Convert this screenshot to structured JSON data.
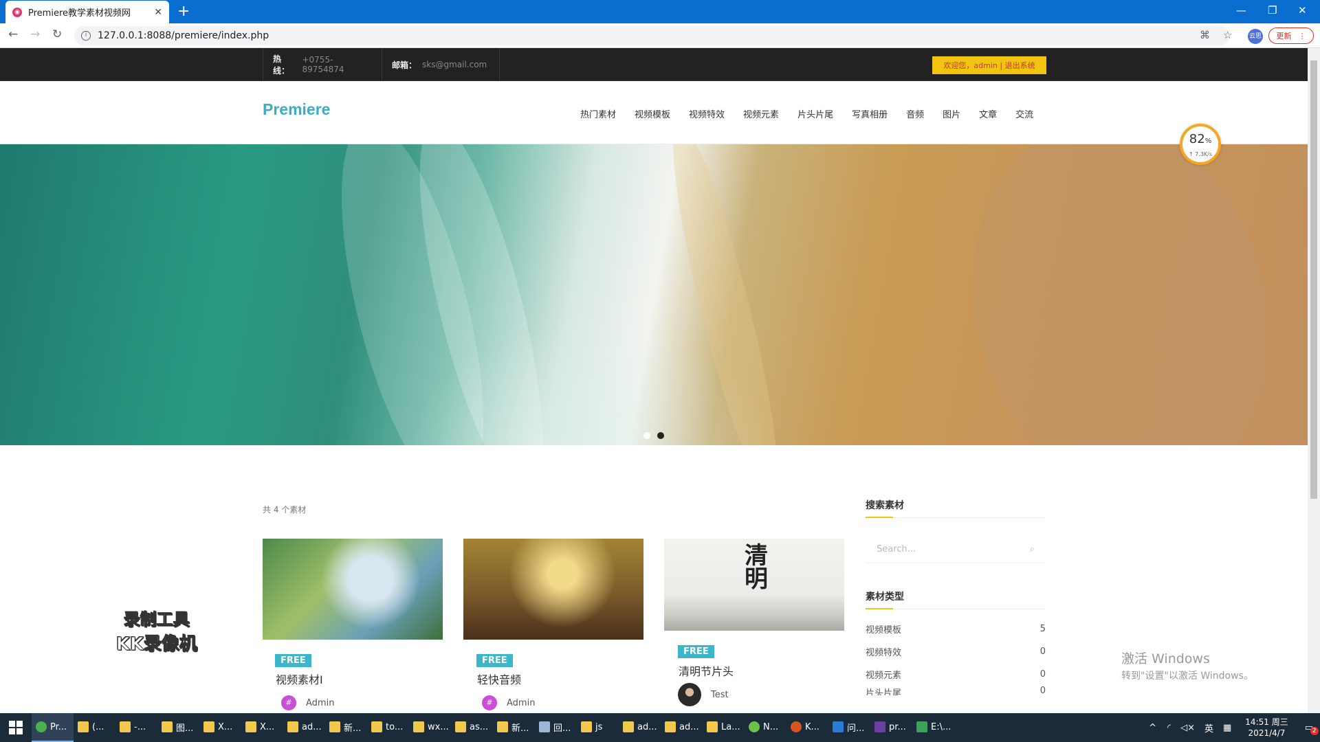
{
  "browser": {
    "tab_title": "Premiere教学素材视频网",
    "url": "127.0.0.1:8088/premiere/index.php",
    "update_label": "更新",
    "profile_label": "云思"
  },
  "topbar": {
    "hotline_key": "热线：",
    "hotline_value": "+0755-89754874",
    "email_key": "邮箱：",
    "email_value": "sks@gmail.com",
    "welcome": "欢迎您，admin | 退出系统"
  },
  "header": {
    "logo": "Premiere",
    "menu": [
      "热门素材",
      "视频模板",
      "视频特效",
      "视频元素",
      "片头片尾",
      "写真相册",
      "音频",
      "图片",
      "文章",
      "交流"
    ]
  },
  "speed_widget": {
    "percent": "82",
    "unit": "%",
    "rate": "↑ 7.3K/s"
  },
  "content": {
    "count_label": "共 4 个素材",
    "cards": [
      {
        "badge": "FREE",
        "title": "视频素材I",
        "author": "Admin",
        "avatar": "#"
      },
      {
        "badge": "FREE",
        "title": "轻快音频",
        "author": "Admin",
        "avatar": "#"
      },
      {
        "badge": "FREE",
        "title": "清明节片头",
        "author": "Test",
        "image_text": "清明"
      }
    ]
  },
  "sidebar": {
    "search_heading": "搜索素材",
    "search_placeholder": "Search...",
    "types_heading": "素材类型",
    "types": [
      {
        "label": "视频模板",
        "count": "5"
      },
      {
        "label": "视频特效",
        "count": "0"
      },
      {
        "label": "视频元素",
        "count": "0"
      },
      {
        "label": "片头片尾",
        "count": "0"
      }
    ]
  },
  "overlay": {
    "watermark_line1": "录制工具",
    "watermark_line2": "KK录像机",
    "activate_line1": "激活 Windows",
    "activate_line2": "转到\"设置\"以激活 Windows。"
  },
  "taskbar": {
    "items": [
      "Pr...",
      "(...",
      "-...",
      "图...",
      "X...",
      "X...",
      "ad...",
      "新...",
      "to...",
      "wx...",
      "as...",
      "新...",
      "回...",
      "js",
      "ad...",
      "ad...",
      "La...",
      "N...",
      "K...",
      "问...",
      "pr...",
      "E:\\..."
    ],
    "ime": "英",
    "time": "14:51 周三",
    "date": "2021/4/7",
    "notifications": "2"
  }
}
